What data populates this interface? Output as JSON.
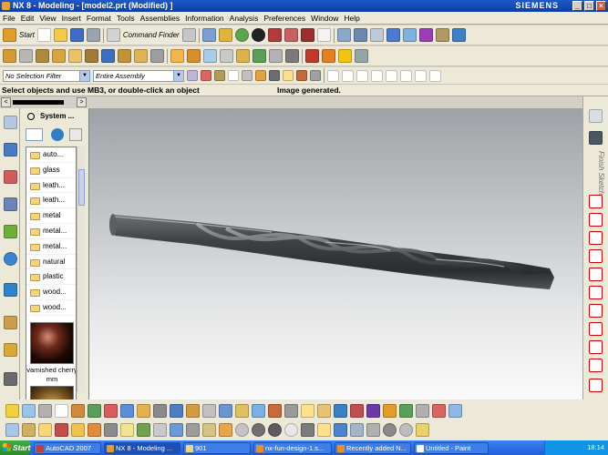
{
  "window": {
    "title": "NX 8 - Modeling - [model2.prt (Modified) ]",
    "brand": "SIEMENS",
    "min": "_",
    "max": "□",
    "close": "×"
  },
  "menu": [
    "File",
    "Edit",
    "View",
    "Insert",
    "Format",
    "Tools",
    "Assemblies",
    "Information",
    "Analysis",
    "Preferences",
    "Window",
    "Help"
  ],
  "toolbar1": {
    "start_label": "Start",
    "command_finder_label": "Command Finder"
  },
  "filters": {
    "selection_filter": "No Selection Filter",
    "assembly_scope": "Entire Assembly"
  },
  "status": {
    "prompt": "Select objects and use MB3, or double-click an object",
    "message": "Image generated."
  },
  "resource_panel": {
    "title": "System ...",
    "materials": [
      "auto...",
      "glass",
      "leath...",
      "leath...",
      "metal",
      "metal...",
      "metal...",
      "natural",
      "plastic",
      "wood...",
      "wood..."
    ],
    "preview_label": "varnished cherry mm"
  },
  "right_toolbar": {
    "sketch_label": "Finish Sketch"
  },
  "taskbar": {
    "start_label": "Start",
    "tasks": [
      "AutoCAD 2007",
      "NX 8 - Modeling ...",
      "901",
      "nx-fun-design-1.s...",
      "Recently added N...",
      "Untitled - Paint"
    ],
    "clock": "18:14"
  },
  "colors": {
    "accent": "#0a3ea8",
    "viewport_top": "#9ea2a6",
    "viewport_bottom": "#fafafa",
    "model": "#4a4c4f"
  }
}
